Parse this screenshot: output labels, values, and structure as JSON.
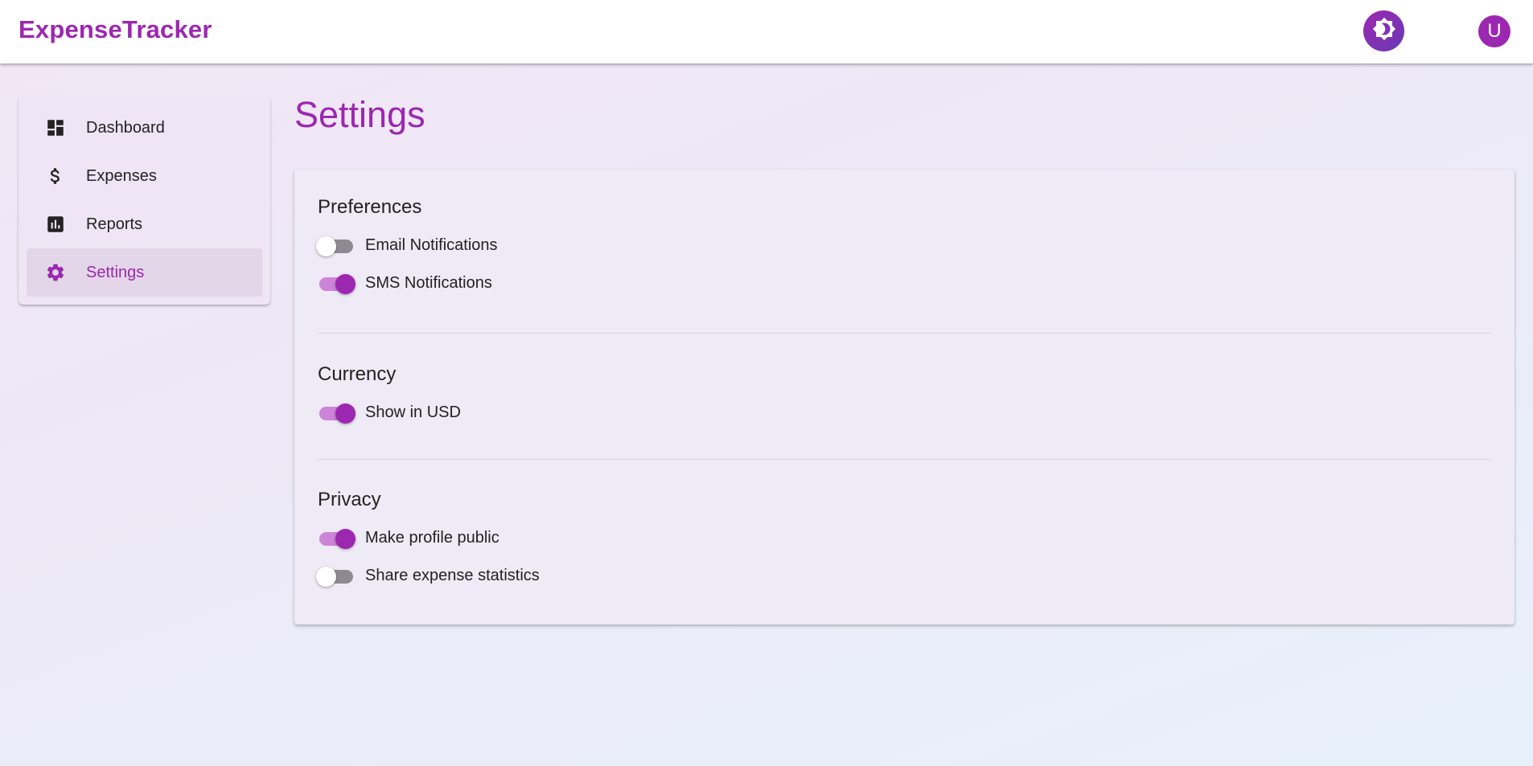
{
  "app": {
    "title": "ExpenseTracker"
  },
  "header": {
    "avatar_initial": "U",
    "theme_icon": "brightness-icon"
  },
  "sidebar": {
    "items": [
      {
        "label": "Dashboard",
        "icon": "dashboard-icon",
        "active": false
      },
      {
        "label": "Expenses",
        "icon": "dollar-icon",
        "active": false
      },
      {
        "label": "Reports",
        "icon": "bar-chart-icon",
        "active": false
      },
      {
        "label": "Settings",
        "icon": "gear-icon",
        "active": true
      }
    ]
  },
  "main": {
    "title": "Settings",
    "sections": [
      {
        "title": "Preferences",
        "toggles": [
          {
            "label": "Email Notifications",
            "on": false
          },
          {
            "label": "SMS Notifications",
            "on": true
          }
        ]
      },
      {
        "title": "Currency",
        "toggles": [
          {
            "label": "Show in USD",
            "on": true
          }
        ]
      },
      {
        "title": "Privacy",
        "toggles": [
          {
            "label": "Make profile public",
            "on": true
          },
          {
            "label": "Share expense statistics",
            "on": false
          }
        ]
      }
    ]
  },
  "colors": {
    "accent": "#9c27b0",
    "accent_light": "#cc84d8",
    "switch_off_track": "#8d8a92",
    "active_nav_bg": "#e2d6e8"
  }
}
